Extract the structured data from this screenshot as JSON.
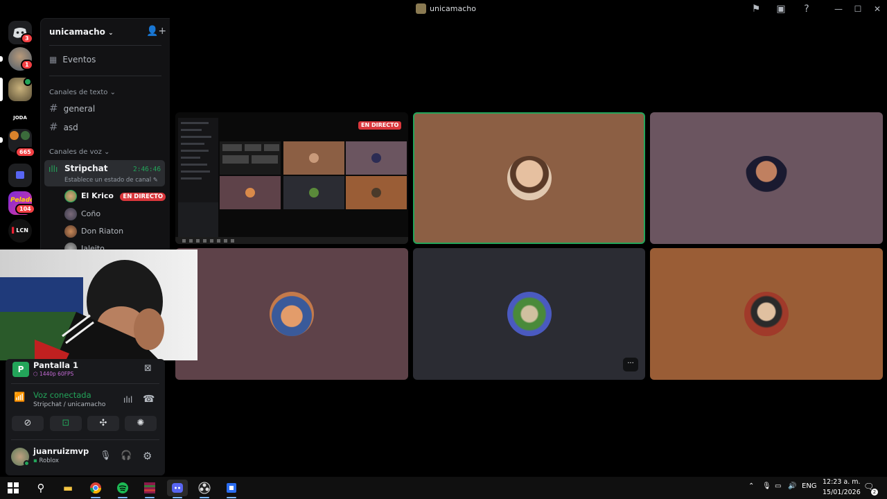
{
  "window": {
    "title": "unicamacho"
  },
  "rail": {
    "home_badge": "3",
    "server1_badge": "1",
    "server_joda_label": "JODA",
    "server4_badge": "665",
    "server6_badge": "104",
    "server7_label": "LCN"
  },
  "sidebar": {
    "server_name": "unicamacho",
    "events_label": "Eventos",
    "text_category": "Canales de texto",
    "text_channels": [
      "general",
      "asd"
    ],
    "voice_category": "Canales de voz",
    "voice_channel": {
      "name": "Stripchat",
      "timer": "2:46:46",
      "status": "Establece un estado de canal"
    },
    "voice_users": [
      {
        "name": "El Krico",
        "live": "EN DIRECTO"
      },
      {
        "name": "Coño"
      },
      {
        "name": "Don Riaton"
      },
      {
        "name": "Jalejto"
      }
    ]
  },
  "panel": {
    "stream_title": "Pantalla 1",
    "stream_quality": "1440p 60FPS",
    "voice_status": "Voz conectada",
    "voice_location": "Stripchat / unicamacho",
    "user_name": "juanruizmvp",
    "user_activity": "Roblox"
  },
  "stage": {
    "live_badge": "EN DIRECTO",
    "more_label": "···"
  },
  "taskbar": {
    "lang": "ENG",
    "time": "12:23 a. m.",
    "date": "15/01/2026",
    "notif_count": "2"
  },
  "colors": {
    "accent_green": "#23a55a",
    "live_red": "#da373c",
    "tile_brown": "#8c5f44",
    "tile_mauve": "#6b5560",
    "tile_dark": "#2b2c33",
    "tile_orange": "#9a5d36",
    "tile_plum": "#5e4249"
  }
}
